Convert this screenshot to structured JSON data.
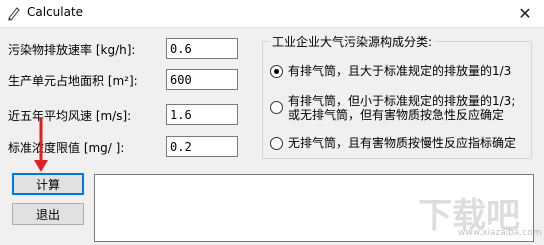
{
  "window": {
    "title": "Calculate",
    "close_glyph": "✕",
    "icon": "pencil-icon"
  },
  "fields": [
    {
      "label": "污染物排放速率  [kg/h]:",
      "value": "0.6"
    },
    {
      "label": "生产单元占地面积  [m²]:",
      "value": "600"
    },
    {
      "label": "近五年平均风速  [m/s]:",
      "value": "1.6"
    },
    {
      "label": "标准浓度限值  [mg/  ]:",
      "value": "0.2"
    }
  ],
  "source_group": {
    "title": "工业企业大气污染源构成分类:",
    "options": [
      {
        "lines": [
          "有排气筒，且大于标准规定的排放量的1/3"
        ],
        "selected": true
      },
      {
        "lines": [
          "有排气筒，但小于标准规定的排放量的1/3;",
          "或无排气筒，但有害物质按急性反应确定"
        ],
        "selected": false
      },
      {
        "lines": [
          "无排气筒，且有害物质按慢性反应指标确定"
        ],
        "selected": false
      }
    ]
  },
  "buttons": {
    "calculate": "计算",
    "exit": "退出"
  },
  "output": {
    "text": ""
  },
  "watermark": {
    "text": "下载吧",
    "sub": "www.xiazaiba.com"
  },
  "colors": {
    "arrow": "#e02020",
    "focus": "#0078d7"
  }
}
